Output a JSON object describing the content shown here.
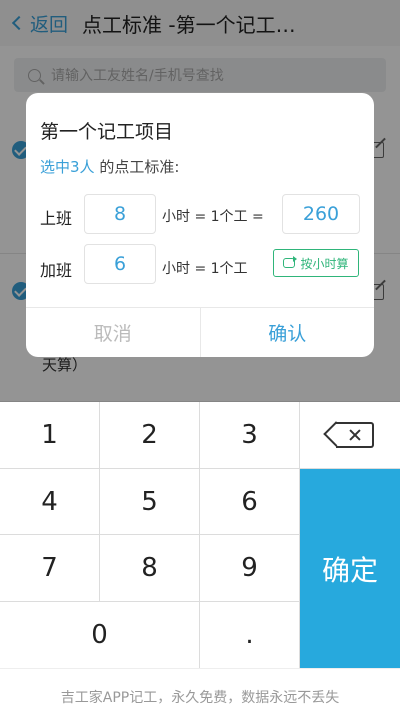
{
  "header": {
    "back_label": "返回",
    "title": "点工标准 -第一个记工…"
  },
  "search": {
    "placeholder": "请输入工友姓名/手机号查找"
  },
  "background": {
    "partial_text": "天算）"
  },
  "dialog": {
    "title": "第一个记工项目",
    "subtitle_highlight": "选中3人",
    "subtitle_rest": " 的点工标准:",
    "rows": [
      {
        "label": "上班",
        "hours": "8",
        "unit": "小时 = 1个工 =",
        "value": "260"
      },
      {
        "label": "加班",
        "hours": "6",
        "unit": "小时 = 1个工",
        "button": "按小时算"
      }
    ],
    "cancel": "取消",
    "confirm": "确认"
  },
  "keypad": {
    "keys": [
      "1",
      "2",
      "3",
      "4",
      "5",
      "6",
      "7",
      "8",
      "9",
      "0",
      "."
    ],
    "confirm": "确定"
  },
  "footer": "吉工家APP记工，永久免费，数据永远不丢失",
  "colors": {
    "accent": "#27a9dd",
    "link": "#3aa0d8",
    "green": "#2fb57a"
  }
}
